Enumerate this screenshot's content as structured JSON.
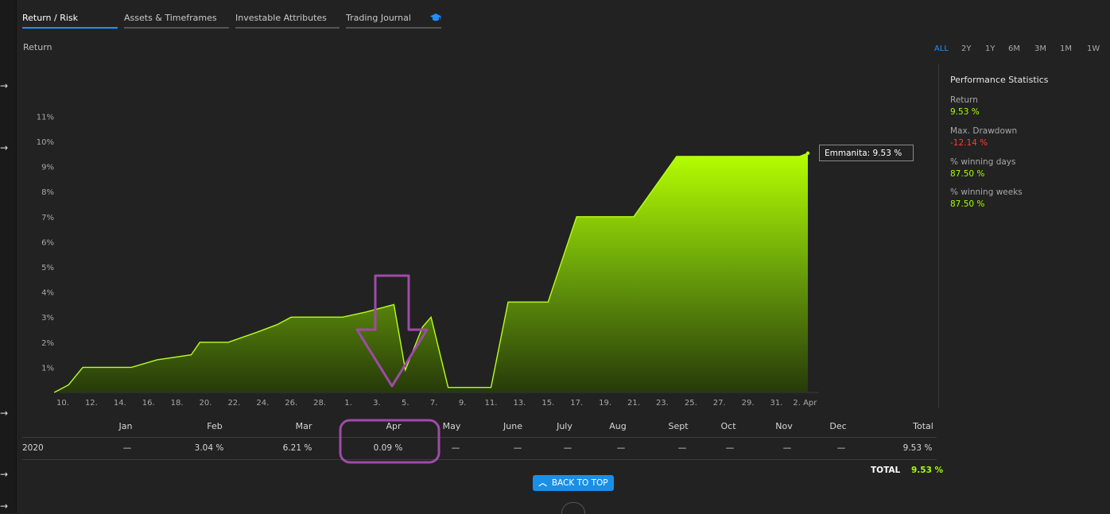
{
  "tabs": [
    {
      "label": "Return / Risk",
      "active": true
    },
    {
      "label": "Assets & Timeframes",
      "active": false
    },
    {
      "label": "Investable Attributes",
      "active": false
    },
    {
      "label": "Trading Journal",
      "active": false,
      "icon": "graduation-cap-icon"
    }
  ],
  "chart_label": "Return",
  "time_ranges": [
    "ALL",
    "2Y",
    "1Y",
    "6M",
    "3M",
    "1M",
    "1W"
  ],
  "active_range": "ALL",
  "tooltip": "Emmanita: 9.53 %",
  "stats": {
    "title": "Performance Statistics",
    "items": [
      {
        "label": "Return",
        "value": "9.53 %",
        "kind": "pos"
      },
      {
        "label": "Max. Drawdown",
        "value": "-12.14 %",
        "kind": "neg"
      },
      {
        "label": "% winning days",
        "value": "87.50 %",
        "kind": "pos"
      },
      {
        "label": "% winning weeks",
        "value": "87.50 %",
        "kind": "pos"
      }
    ]
  },
  "monthly": {
    "headers": [
      "",
      "Jan",
      "Feb",
      "Mar",
      "Apr",
      "May",
      "June",
      "July",
      "Aug",
      "Sept",
      "Oct",
      "Nov",
      "Dec",
      "Total"
    ],
    "rows": [
      {
        "year": "2020",
        "cells": [
          "—",
          "3.04 %",
          "6.21 %",
          "0.09 %",
          "—",
          "—",
          "—",
          "—",
          "—",
          "—",
          "—",
          "—",
          "9.53 %"
        ]
      }
    ],
    "total_label": "TOTAL",
    "total_value": "9.53 %"
  },
  "back_to_top": "BACK TO TOP",
  "colors": {
    "accent": "#1e90ff",
    "positive": "#a6ff00",
    "negative": "#ff3a3a",
    "annotation": "#a04aa8"
  },
  "chart_data": {
    "type": "area",
    "series": [
      {
        "name": "Emmanita"
      }
    ],
    "x_tick_labels": [
      "10.",
      "12.",
      "14.",
      "16.",
      "18.",
      "20.",
      "22.",
      "24.",
      "26.",
      "28.",
      "1.",
      "3.",
      "5.",
      "7.",
      "9.",
      "11.",
      "13.",
      "15.",
      "17.",
      "19.",
      "21.",
      "23.",
      "25.",
      "27.",
      "29.",
      "31.",
      "2. Apr"
    ],
    "y_tick_labels": [
      "1%",
      "2%",
      "3%",
      "4%",
      "5%",
      "6%",
      "7%",
      "8%",
      "9%",
      "10%",
      "11%"
    ],
    "ylim": [
      0,
      11
    ],
    "x_domain": [
      0,
      26.4
    ],
    "points": [
      [
        -0.3,
        0
      ],
      [
        0.2,
        0.3
      ],
      [
        0.7,
        1.0
      ],
      [
        1.2,
        1.0
      ],
      [
        2.4,
        1.0
      ],
      [
        3.3,
        1.3
      ],
      [
        4.5,
        1.5
      ],
      [
        4.8,
        2.0
      ],
      [
        5.4,
        2.0
      ],
      [
        5.8,
        2.0
      ],
      [
        6.8,
        2.4
      ],
      [
        7.5,
        2.7
      ],
      [
        8.0,
        3.0
      ],
      [
        8.5,
        3.0
      ],
      [
        9.8,
        3.0
      ],
      [
        10.6,
        3.2
      ],
      [
        11.6,
        3.5
      ],
      [
        12.0,
        0.9
      ],
      [
        12.6,
        2.6
      ],
      [
        12.9,
        3.0
      ],
      [
        13.5,
        0.2
      ],
      [
        14.5,
        0.2
      ],
      [
        15.0,
        0.2
      ],
      [
        15.6,
        3.6
      ],
      [
        16.5,
        3.6
      ],
      [
        17.0,
        3.6
      ],
      [
        18.0,
        7.0
      ],
      [
        19.0,
        7.0
      ],
      [
        20.0,
        7.0
      ],
      [
        21.5,
        9.4
      ],
      [
        22.5,
        9.4
      ],
      [
        25.0,
        9.4
      ],
      [
        25.8,
        9.4
      ],
      [
        26.1,
        9.53
      ]
    ],
    "last_value": 9.53,
    "grid": false,
    "legend": "none"
  }
}
